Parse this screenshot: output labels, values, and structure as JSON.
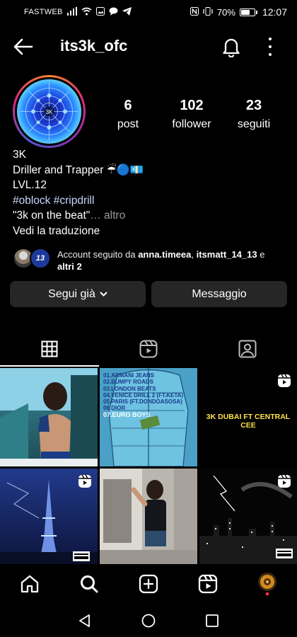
{
  "status_bar": {
    "carrier": "FASTWEB",
    "battery_level_percent": 70,
    "battery_text": "70%",
    "time": "12:07"
  },
  "header": {
    "username": "its3k_ofc",
    "icons": [
      "back-arrow-icon",
      "bell-icon",
      "more-vert-icon"
    ]
  },
  "profile": {
    "stats": [
      {
        "value": "6",
        "label": "post"
      },
      {
        "value": "102",
        "label": "follower"
      },
      {
        "value": "23",
        "label": "seguiti"
      }
    ],
    "name": "3K",
    "bio_line1": "Driller and Trapper ☔🔵💶",
    "bio_line2": "LVL.12",
    "hashtags": "#oblock #cripdrill",
    "bio_quote": "\"3k on the beat\"",
    "more_label": "… altro",
    "translate_label": "Vedi la traduzione"
  },
  "followed_by": {
    "prefix": "Account seguito da ",
    "user1": "anna.timeea",
    "separator": ", ",
    "user2": "itsmatt_14_13",
    "conj": " e",
    "others": "altri 2",
    "mini_avatar_text": "13"
  },
  "actions": {
    "follow_label": "Segui già",
    "message_label": "Messaggio"
  },
  "tabs": [
    "grid-icon",
    "reels-icon",
    "tagged-icon"
  ],
  "posts": [
    {
      "id": "post-1",
      "kind": "photo",
      "reel": false
    },
    {
      "id": "post-2",
      "kind": "tracklist",
      "reel": false,
      "tracklist": [
        "01.ARMANI JEANS",
        "02.BUMPY ROADS",
        "03.LONDON BEATS",
        "04.VENICE DRILL 2 (FT.KETA)",
        "05.PARIS (FT.DONDOASOSA)",
        "06.DIOR",
        "07.EURO BOYS"
      ]
    },
    {
      "id": "post-3",
      "kind": "text",
      "reel": true,
      "caption": "3K DUBAI FT CENTRAL CEE"
    },
    {
      "id": "post-4",
      "kind": "photo",
      "reel": true
    },
    {
      "id": "post-5",
      "kind": "photo",
      "reel": false
    },
    {
      "id": "post-6",
      "kind": "photo",
      "reel": true
    }
  ],
  "bottom_nav": [
    "home-icon",
    "search-icon",
    "add-post-icon",
    "reels-nav-icon",
    "profile-avatar"
  ],
  "system_nav": [
    "back-triangle",
    "home-circle",
    "recents-square"
  ],
  "colors": {
    "background": "#000000",
    "button_bg": "#262626",
    "hashtag": "#c9d7ff",
    "muted": "#9a9a9a",
    "story_ring": [
      "#f58529",
      "#dd2a7b",
      "#8134af",
      "#515bd4"
    ]
  }
}
